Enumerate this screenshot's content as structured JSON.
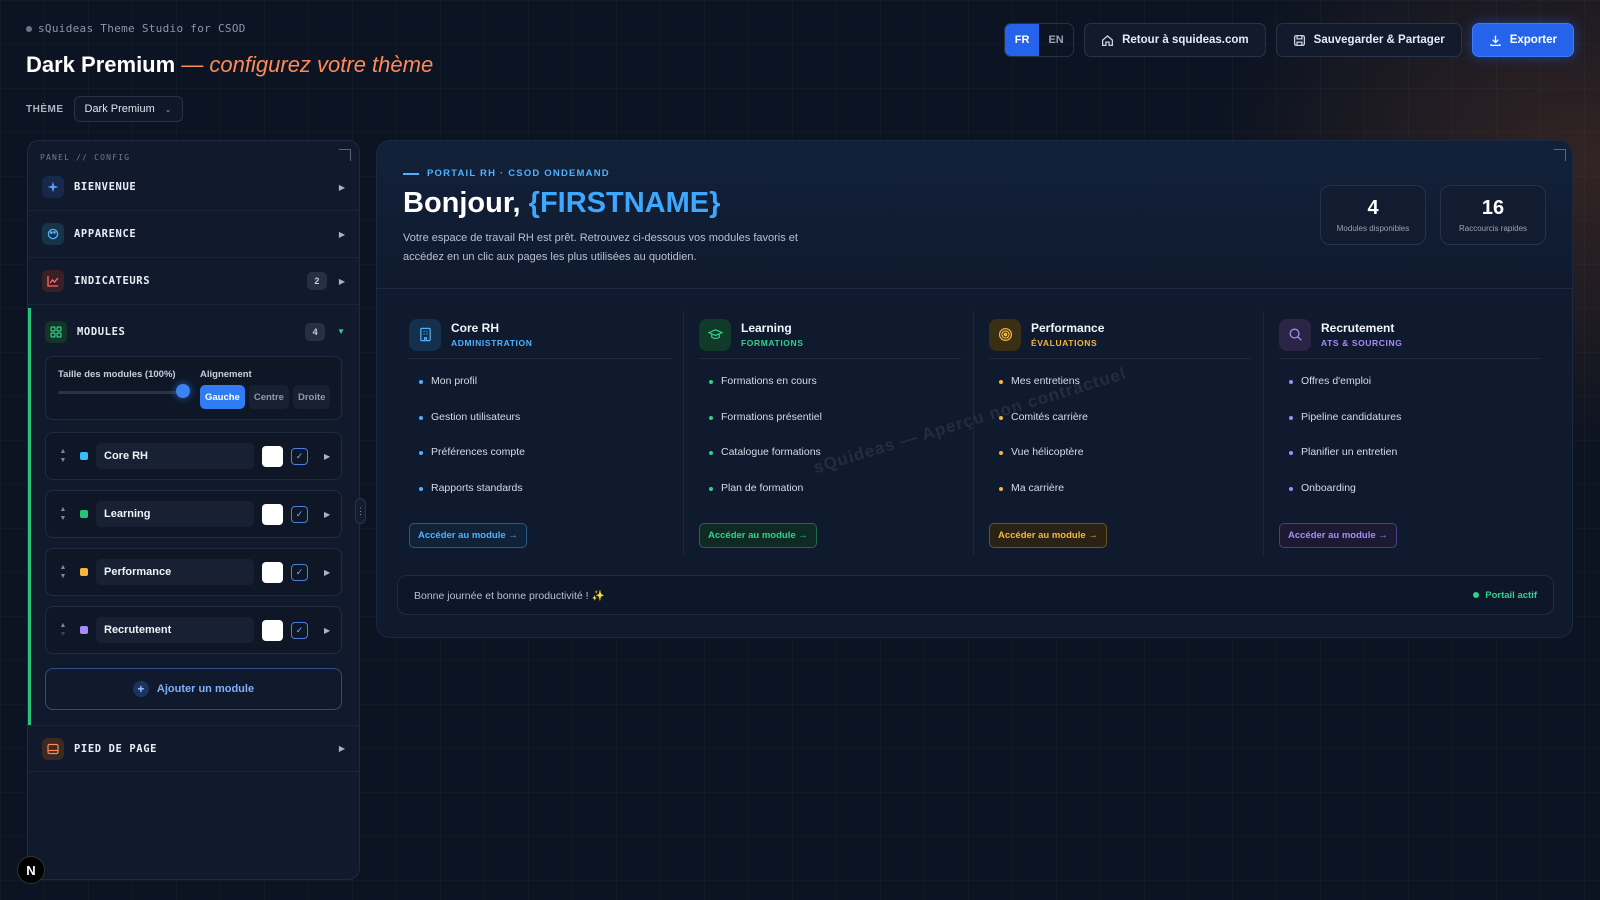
{
  "header": {
    "studio": "sQuideas Theme Studio for CSOD",
    "title": "Dark Premium",
    "subtitle": "— configurez votre thème",
    "theme_label": "THÈME",
    "theme_value": "Dark Premium"
  },
  "topbar": {
    "lang_fr": "FR",
    "lang_en": "EN",
    "back": "Retour à squideas.com",
    "save": "Sauvegarder & Partager",
    "export": "Exporter"
  },
  "panel": {
    "label": "PANEL // CONFIG",
    "sections": {
      "welcome": "BIENVENUE",
      "appearance": "APPARENCE",
      "indicators": "INDICATEURS",
      "indicators_count": "2",
      "modules": "MODULES",
      "modules_count": "4",
      "footer": "PIED DE PAGE"
    },
    "size_label": "Taille des modules (100%)",
    "size_value": 1.0,
    "align_label": "Alignement",
    "align_options": [
      "Gauche",
      "Centre",
      "Droite"
    ],
    "modules": [
      {
        "name": "Core RH",
        "color": "#38bdf8"
      },
      {
        "name": "Learning",
        "color": "#22c57a"
      },
      {
        "name": "Performance",
        "color": "#f5b73b"
      },
      {
        "name": "Recrutement",
        "color": "#a78bfa"
      }
    ],
    "add_module": "Ajouter un module"
  },
  "preview": {
    "kicker": "PORTAIL RH · CSOD ONDEMAND",
    "greeting": "Bonjour,",
    "firstname": "{FIRSTNAME}",
    "intro": "Votre espace de travail RH est prêt. Retrouvez ci-dessous vos modules favoris et accédez en un clic aux pages les plus utilisées au quotidien.",
    "stats": [
      {
        "value": "4",
        "label": "Modules disponibles"
      },
      {
        "value": "16",
        "label": "Raccourcis rapides"
      }
    ],
    "watermark": "sQuideas — Aperçu non contractuel",
    "columns": [
      {
        "name": "Core RH",
        "sub": "ADMINISTRATION",
        "accent": "#4fb1ff",
        "icon": "building-icon",
        "items": [
          "Mon profil",
          "Gestion utilisateurs",
          "Préférences compte",
          "Rapports standards"
        ],
        "cta": "Accéder au module →"
      },
      {
        "name": "Learning",
        "sub": "FORMATIONS",
        "accent": "#2fd28a",
        "icon": "graduation-cap-icon",
        "items": [
          "Formations en cours",
          "Formations présentiel",
          "Catalogue formations",
          "Plan de formation"
        ],
        "cta": "Accéder au module →"
      },
      {
        "name": "Performance",
        "sub": "ÉVALUATIONS",
        "accent": "#f5b73b",
        "icon": "target-icon",
        "items": [
          "Mes entretiens",
          "Comités carrière",
          "Vue hélicoptère",
          "Ma carrière"
        ],
        "cta": "Accéder au module →"
      },
      {
        "name": "Recrutement",
        "sub": "ATS & SOURCING",
        "accent": "#a78bfa",
        "icon": "search-icon",
        "items": [
          "Offres d'emploi",
          "Pipeline candidatures",
          "Planifier un entretien",
          "Onboarding"
        ],
        "cta": "Accéder au module →"
      }
    ],
    "footer_text": "Bonne journée et bonne productivité ! ✨",
    "status": "Portail actif"
  },
  "misc": {
    "logo": "N"
  }
}
